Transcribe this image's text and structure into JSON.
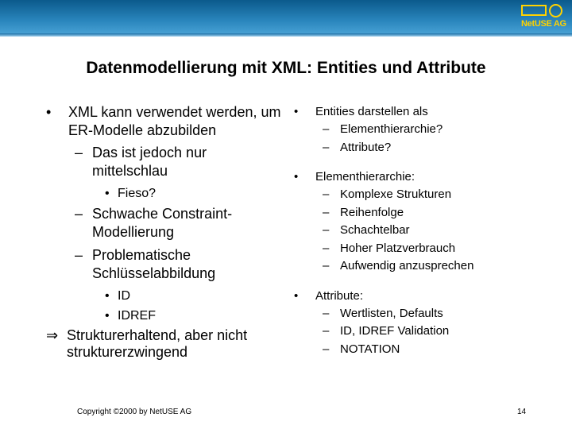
{
  "logo": {
    "text": "NetUSE AG"
  },
  "title": "Datenmodellierung mit XML: Entities und Attribute",
  "left": {
    "bullet": "•",
    "dash": "–",
    "dot": "•",
    "arrow": "⇒",
    "items": [
      "XML kann verwendet werden, um ER-Modelle abzubilden",
      "Das ist jedoch nur mittelschlau",
      "Fieso?",
      "Schwache Constraint-Modellierung",
      "Problematische Schlüsselabbildung",
      "ID",
      "IDREF",
      "Strukturerhaltend, aber nicht strukturerzwingend"
    ]
  },
  "right": {
    "bullet": "•",
    "dash": "–",
    "groups": [
      {
        "label": "Entities darstellen als",
        "subs": [
          "Elementhierarchie?",
          "Attribute?"
        ]
      },
      {
        "label": "Elementhierarchie:",
        "subs": [
          "Komplexe Strukturen",
          "Reihenfolge",
          "Schachtelbar",
          "Hoher Platzverbrauch",
          "Aufwendig anzusprechen"
        ]
      },
      {
        "label": "Attribute:",
        "subs": [
          "Wertlisten, Defaults",
          "ID, IDREF Validation",
          "NOTATION"
        ]
      }
    ]
  },
  "footer": {
    "copyright": "Copyright ©2000 by NetUSE AG",
    "page": "14"
  },
  "colors": {
    "bar": "#0b5a8c",
    "logo": "#ffd200"
  }
}
